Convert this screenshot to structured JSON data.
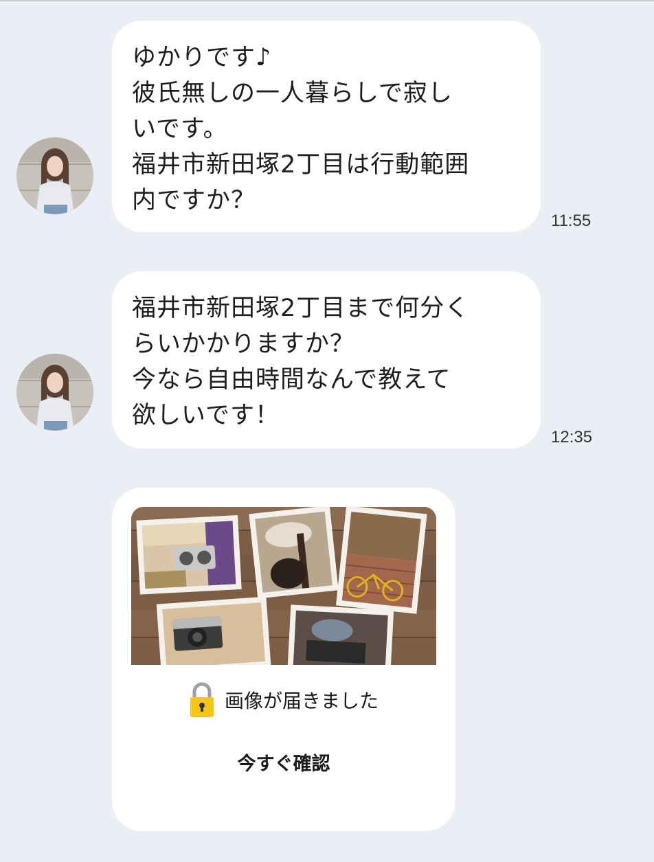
{
  "messages": [
    {
      "text": "ゆかりです♪\n彼氏無しの一人暮らしで寂し\nいです。\n福井市新田塚2丁目は行動範囲\n内ですか？",
      "time": "11:55"
    },
    {
      "text": "福井市新田塚2丁目まで何分く\nらいかかりますか？\n今なら自由時間なんで教えて\n欲しいです！",
      "time": "12:35"
    }
  ],
  "image_card": {
    "notice": "画像が届きました",
    "lock_icon": "lock-icon",
    "confirm_label": "今すぐ確認"
  },
  "colors": {
    "background": "#ebeff5",
    "bubble": "#ffffff",
    "lock": "#f5c518"
  }
}
